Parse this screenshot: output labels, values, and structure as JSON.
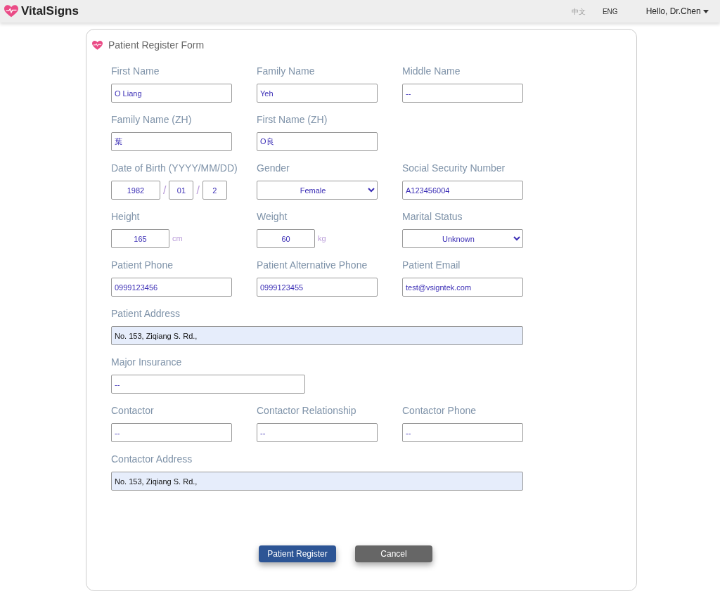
{
  "navbar": {
    "brand": "VitalSigns",
    "languages": [
      {
        "label": "中文",
        "selected": false
      },
      {
        "label": "ENG",
        "selected": true
      }
    ],
    "user_menu": "Hello, Dr.Chen"
  },
  "form": {
    "title": "Patient Register Form",
    "rows": [
      {
        "fields": [
          {
            "kind": "text",
            "label": "First Name",
            "value": "O Liang"
          },
          {
            "kind": "text",
            "label": "Family Name",
            "value": "Yeh"
          },
          {
            "kind": "text",
            "label": "Middle Name",
            "value": "--"
          }
        ]
      },
      {
        "fields": [
          {
            "kind": "text",
            "label": "Family Name (ZH)",
            "value": "葉"
          },
          {
            "kind": "text",
            "label": "First Name (ZH)",
            "value": "O良"
          }
        ]
      },
      {
        "fields": [
          {
            "kind": "date",
            "label": "Date of Birth (YYYY/MM/DD)",
            "parts": [
              "1982",
              "01",
              "2"
            ],
            "separators": [
              "/",
              "/"
            ]
          },
          {
            "kind": "select",
            "label": "Gender",
            "value": "Female"
          },
          {
            "kind": "text",
            "label": "Social Security Number",
            "value": "A123456004"
          }
        ]
      },
      {
        "fields": [
          {
            "kind": "unit",
            "label": "Height",
            "value": "165",
            "unit": "cm"
          },
          {
            "kind": "unit",
            "label": "Weight",
            "value": "60",
            "unit": "kg"
          },
          {
            "kind": "select",
            "label": "Marital Status",
            "value": "Unknown"
          }
        ]
      },
      {
        "fields": [
          {
            "kind": "text",
            "label": "Patient Phone",
            "value": "0999123456"
          },
          {
            "kind": "text",
            "label": "Patient Alternative Phone",
            "value": "0999123455"
          },
          {
            "kind": "text",
            "label": "Patient Email",
            "value": "test@vsigntek.com"
          }
        ]
      },
      {
        "fields": [
          {
            "kind": "wide",
            "label": "Patient Address",
            "value": "No. 153, Ziqiang S. Rd.,",
            "autofilled": true
          }
        ]
      },
      {
        "fields": [
          {
            "kind": "medium",
            "label": "Major Insurance",
            "value": "--"
          }
        ]
      },
      {
        "fields": [
          {
            "kind": "text",
            "label": "Contactor",
            "value": "--"
          },
          {
            "kind": "text",
            "label": "Contactor Relationship",
            "value": "--"
          },
          {
            "kind": "text",
            "label": "Contactor Phone",
            "value": "--"
          }
        ]
      },
      {
        "fields": [
          {
            "kind": "wide",
            "label": "Contactor Address",
            "value": "No. 153, Ziqiang S. Rd.,",
            "autofilled": true
          }
        ]
      }
    ],
    "buttons": [
      {
        "kind": "primary",
        "label": "Patient Register"
      },
      {
        "kind": "secondary",
        "label": "Cancel"
      }
    ]
  }
}
